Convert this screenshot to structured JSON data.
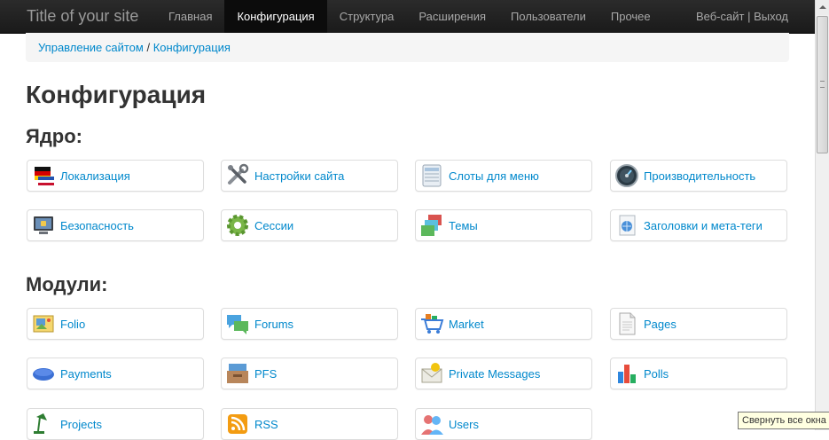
{
  "navbar": {
    "brand": "Title of your site",
    "items": [
      {
        "label": "Главная",
        "active": false
      },
      {
        "label": "Конфигурация",
        "active": true
      },
      {
        "label": "Структура",
        "active": false
      },
      {
        "label": "Расширения",
        "active": false
      },
      {
        "label": "Пользователи",
        "active": false
      },
      {
        "label": "Прочее",
        "active": false
      }
    ],
    "website": "Веб-сайт",
    "separator": "|",
    "logout": "Выход"
  },
  "breadcrumb": {
    "parent": "Управление сайтом",
    "separator": "/",
    "current": "Конфигурация"
  },
  "page_title": "Конфигурация",
  "core": {
    "heading": "Ядро:",
    "items": [
      {
        "label": "Локализация",
        "icon": "flags-icon"
      },
      {
        "label": "Настройки сайта",
        "icon": "tools-icon"
      },
      {
        "label": "Слоты для меню",
        "icon": "menu-slots-icon"
      },
      {
        "label": "Производительность",
        "icon": "gauge-icon"
      },
      {
        "label": "Безопасность",
        "icon": "monitor-lock-icon"
      },
      {
        "label": "Сессии",
        "icon": "gear-icon"
      },
      {
        "label": "Темы",
        "icon": "themes-icon"
      },
      {
        "label": "Заголовки и мета-теги",
        "icon": "meta-tags-icon"
      }
    ]
  },
  "modules": {
    "heading": "Модули:",
    "items": [
      {
        "label": "Folio",
        "icon": "folio-icon"
      },
      {
        "label": "Forums",
        "icon": "forums-icon"
      },
      {
        "label": "Market",
        "icon": "cart-icon"
      },
      {
        "label": "Pages",
        "icon": "page-icon"
      },
      {
        "label": "Payments",
        "icon": "payments-icon"
      },
      {
        "label": "PFS",
        "icon": "pfs-icon"
      },
      {
        "label": "Private Messages",
        "icon": "envelope-icon"
      },
      {
        "label": "Polls",
        "icon": "bar-chart-icon"
      },
      {
        "label": "Projects",
        "icon": "desk-lamp-icon"
      },
      {
        "label": "RSS",
        "icon": "rss-icon"
      },
      {
        "label": "Users",
        "icon": "users-icon"
      }
    ]
  },
  "tooltip": "Свернуть все окна",
  "colors": {
    "link": "#0088cc",
    "navbar": "#1b1b1b",
    "breadcrumb_bg": "#f5f5f5"
  }
}
